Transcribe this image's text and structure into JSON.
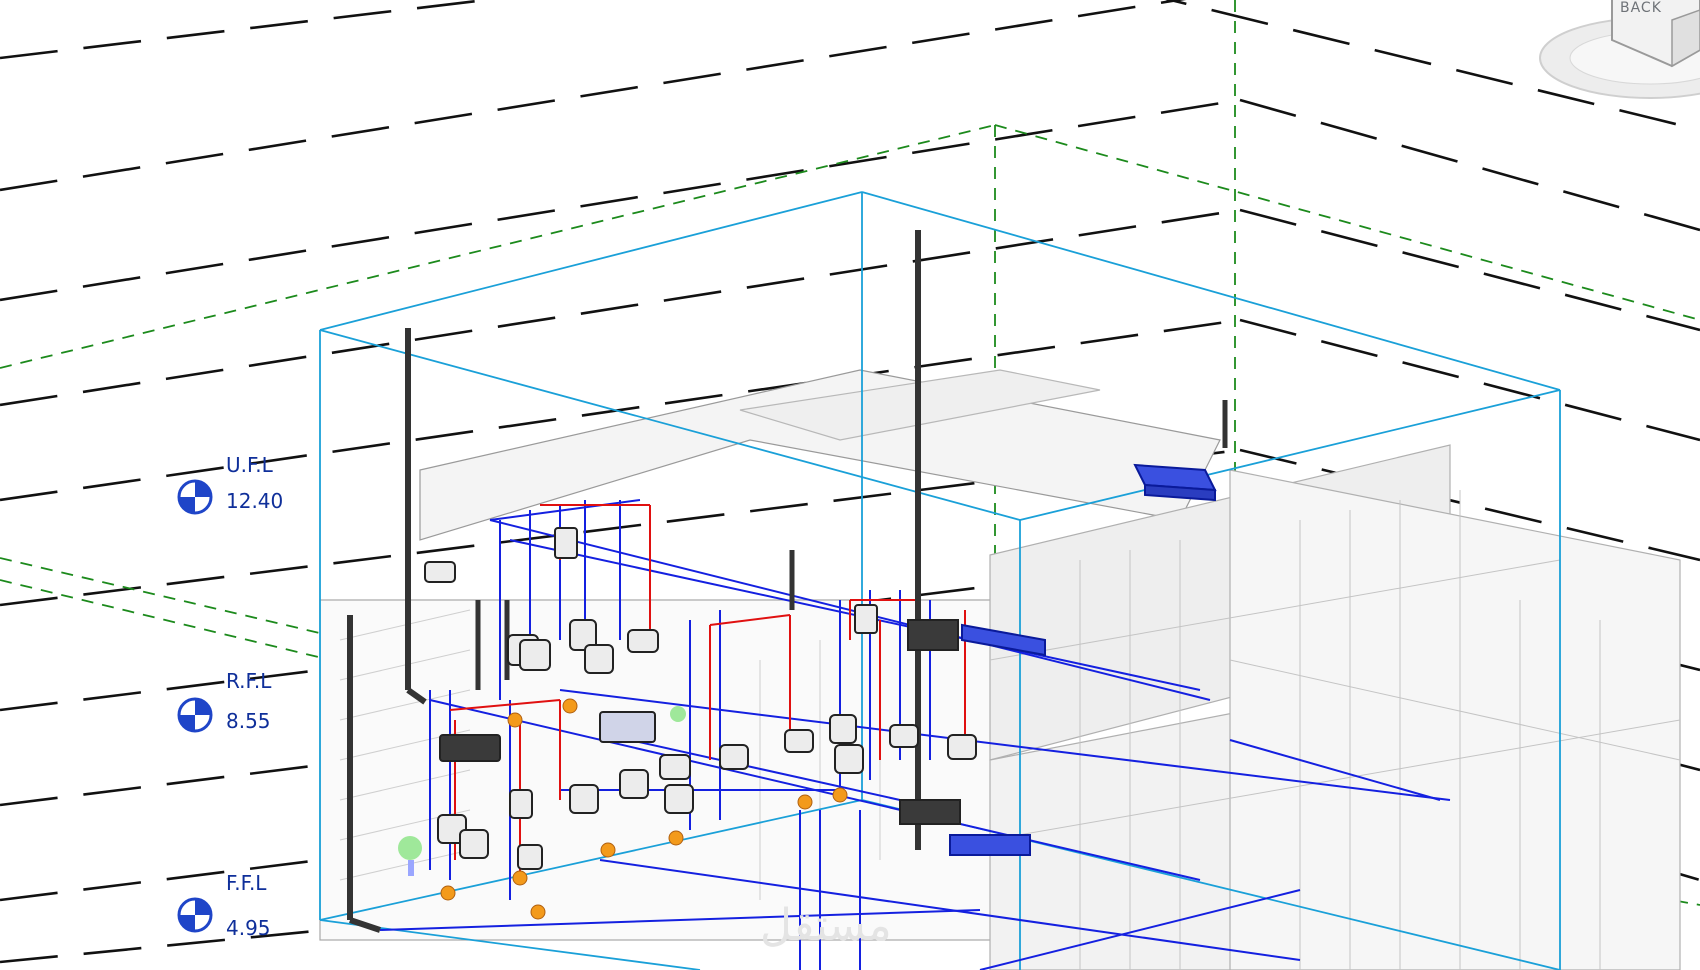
{
  "view": {
    "name": "3d-mep-view",
    "colors": {
      "background": "#ffffff",
      "gridline": "#111111",
      "level_line": "#1c8a1c",
      "section_box": "#1aa0d8",
      "pipe_cold": "#1420e0",
      "pipe_hot": "#e01010",
      "level_marker": "#1f45c8",
      "fitting": "#f39a1b"
    }
  },
  "viewcube": {
    "face_label": "BACK",
    "icon": "viewcube-icon"
  },
  "levels": [
    {
      "id": "ufl",
      "name": "U.F.L",
      "elevation": "12.40",
      "icon": "level-head-icon"
    },
    {
      "id": "rfl",
      "name": "R.F.L",
      "elevation": "8.55",
      "icon": "level-head-icon"
    },
    {
      "id": "ffl",
      "name": "F.F.L",
      "elevation": "4.95",
      "icon": "level-head-icon"
    }
  ],
  "watermark": {
    "text": "مستقل"
  }
}
